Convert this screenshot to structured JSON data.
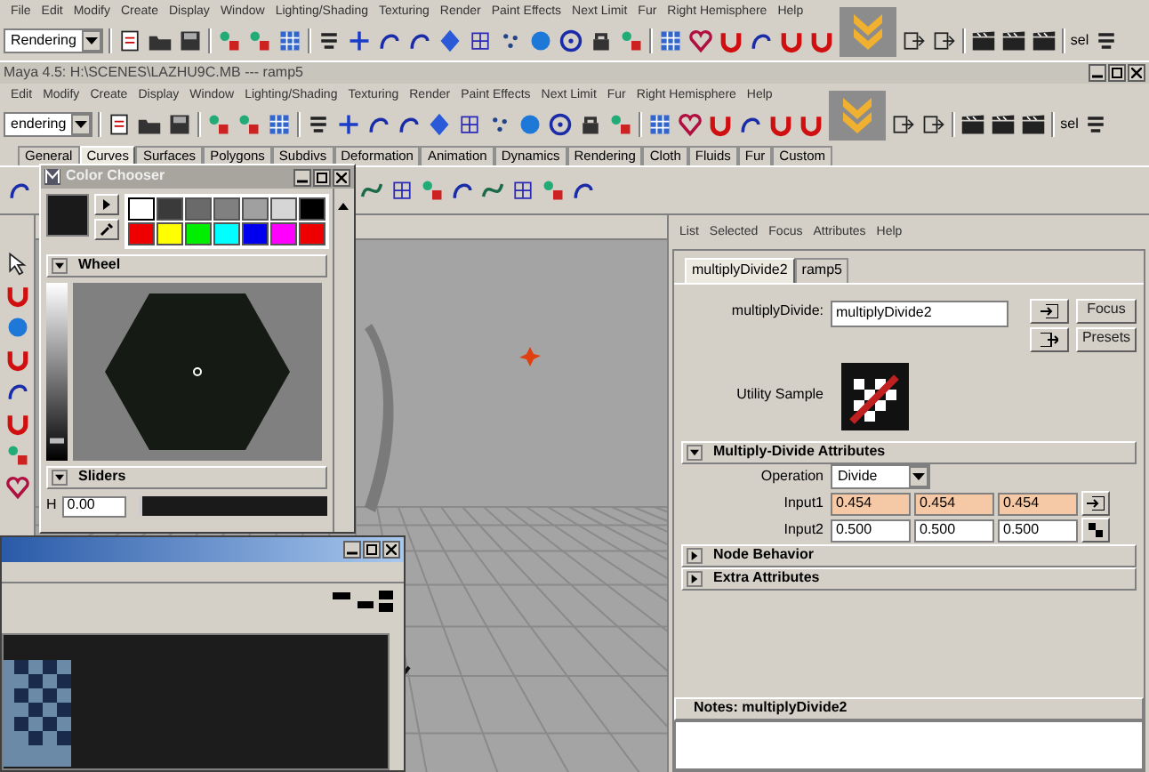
{
  "back_window": {
    "menu": [
      "File",
      "Edit",
      "Modify",
      "Create",
      "Display",
      "Window",
      "Lighting/Shading",
      "Texturing",
      "Render",
      "Paint Effects",
      "Next Limit",
      "Fur",
      "Right Hemisphere",
      "Help"
    ],
    "toolbar": {
      "dropdown": "Rendering",
      "selection_label": "sel"
    }
  },
  "main_window": {
    "title": "Maya 4.5: H:\\SCENES\\LAZHU9C.MB --- ramp5",
    "menu": [
      "Edit",
      "Modify",
      "Create",
      "Display",
      "Window",
      "Lighting/Shading",
      "Texturing",
      "Render",
      "Paint Effects",
      "Next Limit",
      "Fur",
      "Right Hemisphere",
      "Help"
    ],
    "toolbar": {
      "dropdown": "endering",
      "selection_label": "sel"
    },
    "shelf_tabs": [
      {
        "label": "General",
        "selected": false
      },
      {
        "label": "Curves",
        "selected": true
      },
      {
        "label": "Surfaces",
        "selected": false
      },
      {
        "label": "Polygons",
        "selected": false
      },
      {
        "label": "Subdivs",
        "selected": false
      },
      {
        "label": "Deformation",
        "selected": false
      },
      {
        "label": "Animation",
        "selected": false
      },
      {
        "label": "Dynamics",
        "selected": false
      },
      {
        "label": "Rendering",
        "selected": false
      },
      {
        "label": "Cloth",
        "selected": false
      },
      {
        "label": "Fluids",
        "selected": false
      },
      {
        "label": "Fur",
        "selected": false
      },
      {
        "label": "Custom",
        "selected": false
      }
    ]
  },
  "color_chooser": {
    "title": "Color Chooser",
    "swatches": [
      {
        "color": "#ffffff",
        "selected": true
      },
      {
        "color": "#3a3a3a",
        "selected": false
      },
      {
        "color": "#6a6a6a",
        "selected": false
      },
      {
        "color": "#808080",
        "selected": false
      },
      {
        "color": "#a0a0a0",
        "selected": false
      },
      {
        "color": "#d6d6d6",
        "selected": false
      },
      {
        "color": "#000000",
        "selected": false
      },
      {
        "color": "#ee0000",
        "selected": false
      },
      {
        "color": "#ffff00",
        "selected": false
      },
      {
        "color": "#00ee00",
        "selected": false
      },
      {
        "color": "#00ffff",
        "selected": false
      },
      {
        "color": "#0000ee",
        "selected": false
      },
      {
        "color": "#ff00ff",
        "selected": false
      },
      {
        "color": "#ee0000",
        "selected": false
      }
    ],
    "sections": [
      {
        "label": "Wheel",
        "expanded": true
      },
      {
        "label": "Sliders",
        "expanded": true
      }
    ],
    "value_slider": {
      "level": 0.1
    },
    "h_label": "H",
    "h_value": "0.00",
    "hue_slider": {
      "level": 0
    }
  },
  "attribute_editor": {
    "menu": [
      "List",
      "Selected",
      "Focus",
      "Attributes",
      "Help"
    ],
    "tabs": [
      {
        "label": "multiplyDivide2",
        "selected": true
      },
      {
        "label": "ramp5",
        "selected": false
      }
    ],
    "node_label": "multiplyDivide:",
    "node_value": "multiplyDivide2",
    "buttons": [
      "Focus",
      "Presets"
    ],
    "sample_label": "Utility Sample",
    "sections": [
      {
        "label": "Multiply-Divide Attributes",
        "expanded": true,
        "operation": {
          "label": "Operation",
          "value": "Divide"
        },
        "inputs": [
          {
            "label": "Input1",
            "values": [
              "0.454",
              "0.454",
              "0.454"
            ],
            "connected": true
          },
          {
            "label": "Input2",
            "values": [
              "0.500",
              "0.500",
              "0.500"
            ],
            "connected": false
          }
        ]
      },
      {
        "label": "Node Behavior",
        "expanded": false
      },
      {
        "label": "Extra Attributes",
        "expanded": false
      }
    ],
    "notes_label": "Notes: multiplyDivide2"
  }
}
